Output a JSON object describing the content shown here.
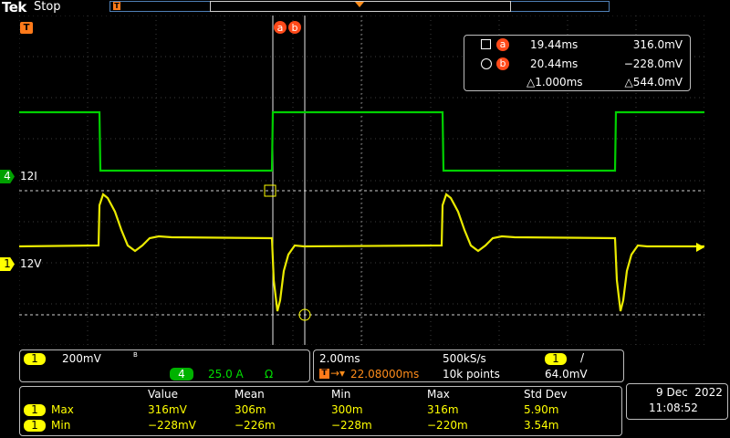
{
  "header": {
    "brand": "Tek",
    "acq_state": "Stop",
    "trigger_marker": "T"
  },
  "waveforms": {
    "ch4": {
      "label": "12I",
      "number": "4",
      "color": "#00e000"
    },
    "ch1": {
      "label": "12V",
      "number": "1",
      "color": "#ffff00"
    },
    "trigger_marker": "T"
  },
  "cursors": {
    "a_label": "a",
    "b_label": "b",
    "a_time": "19.44ms",
    "a_value": "316.0mV",
    "b_time": "20.44ms",
    "b_value": "−228.0mV",
    "delta_time": "△1.000ms",
    "delta_value": "△544.0mV"
  },
  "channel_panel": {
    "ch1_number": "1",
    "ch1_scale": "200mV",
    "ch1_bw": "B",
    "ch4_number": "4",
    "ch4_scale": "25.0 A",
    "ch4_unit": "Ω"
  },
  "timebase_panel": {
    "time_per_div": "2.00ms",
    "sample_rate": "500kS/s",
    "trigger_channel": "1",
    "trigger_slope": "/",
    "trigger_position": "22.08000ms",
    "record_length": "10k points",
    "trigger_level": "64.0mV"
  },
  "measurements": {
    "headers": [
      "Value",
      "Mean",
      "Min",
      "Max",
      "Std Dev"
    ],
    "rows": [
      {
        "channel": "1",
        "name": "Max",
        "values": [
          "316mV",
          "306m",
          "300m",
          "316m",
          "5.90m"
        ]
      },
      {
        "channel": "1",
        "name": "Min",
        "values": [
          "−228mV",
          "−226m",
          "−228m",
          "−220m",
          "3.54m"
        ]
      }
    ]
  },
  "datetime": {
    "date": "9 Dec  2022",
    "time": "11:08:52"
  }
}
